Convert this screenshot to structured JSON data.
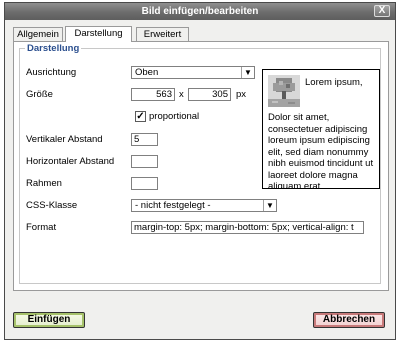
{
  "window": {
    "title": "Bild einfügen/bearbeiten",
    "close_glyph": "X"
  },
  "tabs": [
    {
      "label": "Allgemein",
      "active": false
    },
    {
      "label": "Darstellung",
      "active": true
    },
    {
      "label": "Erweitert",
      "active": false
    }
  ],
  "section": {
    "legend": "Darstellung"
  },
  "form": {
    "alignment_label": "Ausrichtung",
    "alignment_value": "Oben",
    "size_label": "Größe",
    "width_value": "563",
    "times_glyph": "x",
    "height_value": "305",
    "unit": "px",
    "proportional_label": "proportional",
    "proportional_checked": true,
    "vspace_label": "Vertikaler Abstand",
    "vspace_value": "5",
    "hspace_label": "Horizontaler Abstand",
    "hspace_value": "",
    "border_label": "Rahmen",
    "border_value": "",
    "css_class_label": "CSS-Klasse",
    "css_class_value": "- nicht festgelegt -",
    "style_label": "Format",
    "style_value": "margin-top: 5px; margin-bottom: 5px; vertical-align: t"
  },
  "preview": {
    "heading_text": "Lorem ipsum,",
    "lines": [
      "Dolor sit amet,",
      "consectetuer adipiscing",
      "loreum ipsum edipiscing",
      "elit, sed diam nonummy",
      "nibh euismod tincidunt ut",
      "laoreet dolore magna",
      "aliquam erat"
    ]
  },
  "buttons": {
    "insert": "Einfügen",
    "cancel": "Abbrechen"
  },
  "icons": {
    "arrow": "chevron-down-icon",
    "check": "checkmark-icon",
    "close": "close-icon"
  }
}
